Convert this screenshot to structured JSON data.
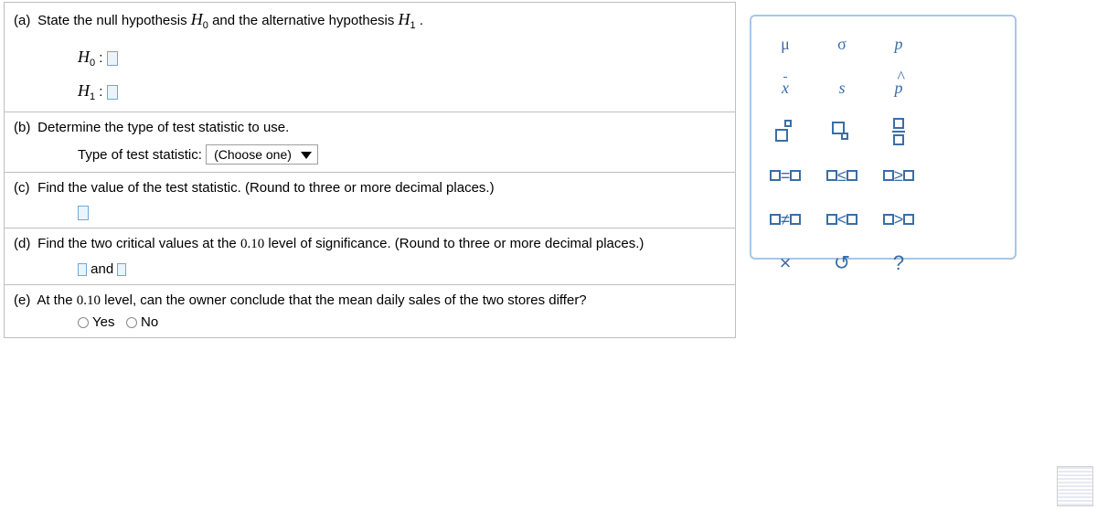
{
  "a": {
    "label": "(a)",
    "text1": "State the null hypothesis ",
    "h0": "H",
    "sub0": "0",
    "text2": " and the alternative hypothesis ",
    "h1": "H",
    "sub1": "1",
    "text3": ".",
    "hline0_left": "H",
    "hline0_sub": "0",
    "colon": " : ",
    "hline1_left": "H",
    "hline1_sub": "1"
  },
  "b": {
    "label": "(b)",
    "text": "Determine the type of test statistic to use.",
    "prompt": "Type of test statistic:",
    "select": "(Choose one)"
  },
  "c": {
    "label": "(c)",
    "text": "Find the value of the test statistic. (Round to three or more decimal places.)"
  },
  "d": {
    "label": "(d)",
    "text1": "Find the two critical values at the ",
    "val": "0.10",
    "text2": " level of significance. (Round to three or more decimal places.)",
    "and": " and "
  },
  "e": {
    "label": "(e)",
    "text1": "At the ",
    "val": "0.10",
    "text2": " level, can the owner conclude that the mean daily sales of the two stores differ?",
    "yes": "Yes",
    "no": "No"
  },
  "pal": {
    "mu": "μ",
    "sigma": "σ",
    "p": "p",
    "xbar": "x",
    "s": "s",
    "phat": "p",
    "eq": "=",
    "le": "≤",
    "ge": "≥",
    "ne": "≠",
    "lt": "<",
    "gt": ">",
    "clear": "×",
    "undo": "↺",
    "help": "?"
  }
}
